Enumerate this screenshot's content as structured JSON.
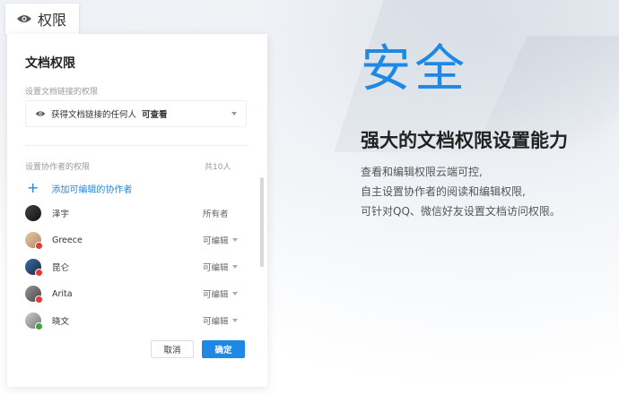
{
  "tag": {
    "label": "权限",
    "icon": "eye-icon"
  },
  "panel": {
    "title": "文档权限",
    "link_section_label": "设置文档链接的权限",
    "link_select": {
      "icon": "eye-icon",
      "text": "获得文档链接的任何人",
      "permission": "可查看"
    },
    "collab_section_label": "设置协作者的权限",
    "collab_count": "共10人",
    "add_label": "添加可编辑的协作者",
    "members": [
      {
        "name": "泽宇",
        "role": "所有者",
        "has_caret": false
      },
      {
        "name": "Greece",
        "role": "可编辑",
        "has_caret": true
      },
      {
        "name": "昆仑",
        "role": "可编辑",
        "has_caret": true
      },
      {
        "name": "Arita",
        "role": "可编辑",
        "has_caret": true
      },
      {
        "name": "晓文",
        "role": "可编辑",
        "has_caret": true
      }
    ],
    "cancel_label": "取消",
    "ok_label": "确定"
  },
  "hero": {
    "title": "安全",
    "subtitle": "强大的文档权限设置能力",
    "desc_lines": [
      "查看和编辑权限云端可控,",
      "自主设置协作者的阅读和编辑权限,",
      "可针对QQ、微信好友设置文档访问权限。"
    ]
  },
  "colors": {
    "accent": "#1e88e5",
    "avatar_badge": "#e53935"
  }
}
